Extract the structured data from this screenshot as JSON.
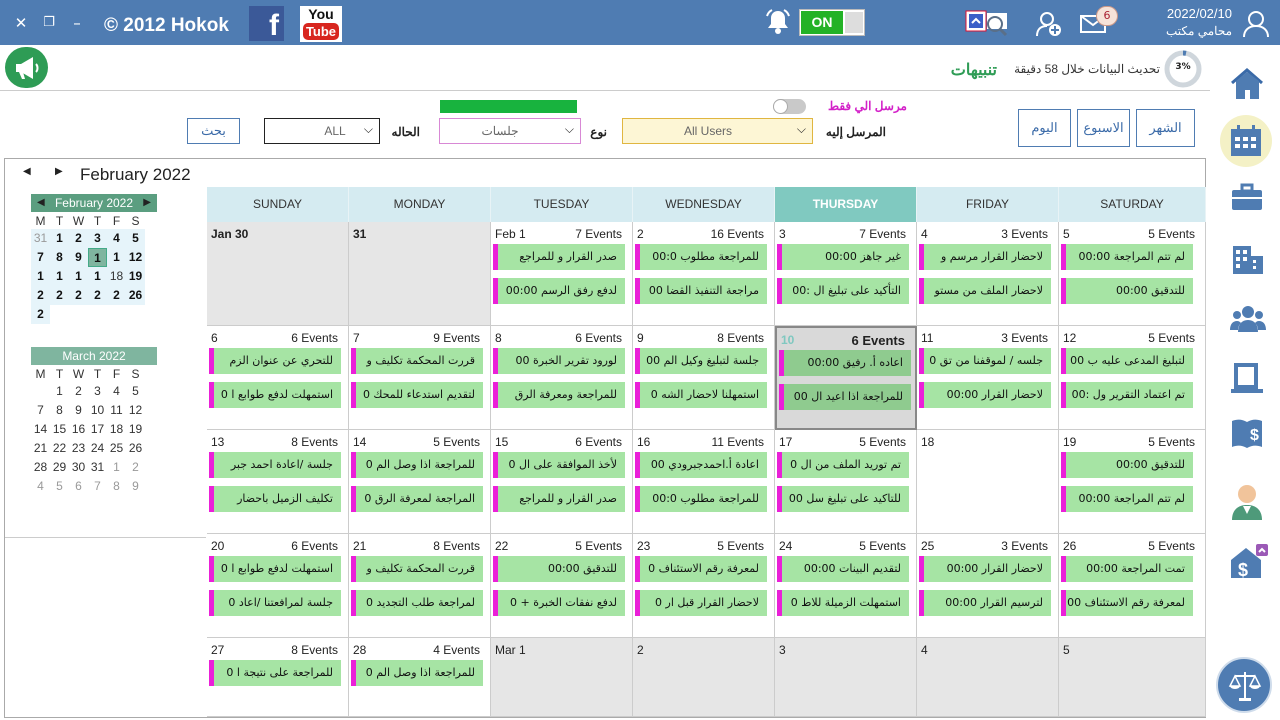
{
  "titlebar": {
    "brand": "© 2012 Hokok",
    "facebook_letter": "f",
    "youtube_you": "You",
    "youtube_tube": "Tube",
    "toggle_label": "ON",
    "mail_count": "6",
    "date": "2022/02/10",
    "user_role": "محامي مكتب",
    "accent": "#4f7cb2"
  },
  "notices": {
    "link": "تنبيهات",
    "update_text": "تحديث البيانات خلال 58 دقيقة",
    "progress_label": "3%",
    "progress_fraction": 0.03
  },
  "filters": {
    "view_month": "الشهر",
    "view_week": "الاسبوع",
    "view_today": "اليوم",
    "only_me_label": "مرسل الي فقط",
    "recipient_label": "المرسل إليه",
    "recipient_value": "All Users",
    "type_label": "نوع",
    "type_value": "جلسات",
    "status_label": "الحاله",
    "status_value": "ALL",
    "search_button": "بحث"
  },
  "calendar": {
    "month_title": "February 2022",
    "weekdays": [
      "SUNDAY",
      "MONDAY",
      "TUESDAY",
      "WEDNESDAY",
      "THURSDAY",
      "FRIDAY",
      "SATURDAY"
    ],
    "active_weekday": 4,
    "mini_dow": [
      "M",
      "T",
      "W",
      "T",
      "F",
      "S"
    ],
    "mini_feb": {
      "title": "February 2022",
      "rows": [
        [
          {
            "t": "31",
            "c": "o hl"
          },
          {
            "t": "1",
            "c": "b hl"
          },
          {
            "t": "2",
            "c": "b hl"
          },
          {
            "t": "3",
            "c": "b hl"
          },
          {
            "t": "4",
            "c": "b hl"
          },
          {
            "t": "5",
            "c": "b hl"
          }
        ],
        [
          {
            "t": "7",
            "c": "b hl"
          },
          {
            "t": "8",
            "c": "b hl"
          },
          {
            "t": "9",
            "c": "b hl"
          },
          {
            "t": "1",
            "c": "today"
          },
          {
            "t": "1",
            "c": "b hl"
          },
          {
            "t": "12",
            "c": "b hl"
          }
        ],
        [
          {
            "t": "1",
            "c": "b hl"
          },
          {
            "t": "1",
            "c": "b hl"
          },
          {
            "t": "1",
            "c": "b hl"
          },
          {
            "t": "1",
            "c": "b hl"
          },
          {
            "t": "18",
            "c": "hl"
          },
          {
            "t": "19",
            "c": "b hl"
          }
        ],
        [
          {
            "t": "2",
            "c": "b hl"
          },
          {
            "t": "2",
            "c": "b hl"
          },
          {
            "t": "2",
            "c": "b hl"
          },
          {
            "t": "2",
            "c": "b hl"
          },
          {
            "t": "2",
            "c": "b hl"
          },
          {
            "t": "26",
            "c": "b hl"
          }
        ],
        [
          {
            "t": "2",
            "c": "b hl"
          }
        ]
      ]
    },
    "mini_mar": {
      "title": "March 2022",
      "rows": [
        [
          {
            "t": "",
            "c": ""
          },
          {
            "t": "1",
            "c": ""
          },
          {
            "t": "2",
            "c": ""
          },
          {
            "t": "3",
            "c": ""
          },
          {
            "t": "4",
            "c": ""
          },
          {
            "t": "5",
            "c": ""
          }
        ],
        [
          {
            "t": "7",
            "c": ""
          },
          {
            "t": "8",
            "c": ""
          },
          {
            "t": "9",
            "c": ""
          },
          {
            "t": "10",
            "c": ""
          },
          {
            "t": "11",
            "c": ""
          },
          {
            "t": "12",
            "c": ""
          }
        ],
        [
          {
            "t": "14",
            "c": ""
          },
          {
            "t": "15",
            "c": ""
          },
          {
            "t": "16",
            "c": ""
          },
          {
            "t": "17",
            "c": ""
          },
          {
            "t": "18",
            "c": ""
          },
          {
            "t": "19",
            "c": ""
          }
        ],
        [
          {
            "t": "21",
            "c": ""
          },
          {
            "t": "22",
            "c": ""
          },
          {
            "t": "23",
            "c": ""
          },
          {
            "t": "24",
            "c": ""
          },
          {
            "t": "25",
            "c": ""
          },
          {
            "t": "26",
            "c": ""
          }
        ],
        [
          {
            "t": "28",
            "c": ""
          },
          {
            "t": "29",
            "c": ""
          },
          {
            "t": "30",
            "c": ""
          },
          {
            "t": "31",
            "c": ""
          },
          {
            "t": "1",
            "c": "o"
          },
          {
            "t": "2",
            "c": "o"
          }
        ],
        [
          {
            "t": "4",
            "c": "o"
          },
          {
            "t": "5",
            "c": "o"
          },
          {
            "t": "6",
            "c": "o"
          },
          {
            "t": "7",
            "c": "o"
          },
          {
            "t": "8",
            "c": "o"
          },
          {
            "t": "9",
            "c": "o"
          }
        ]
      ]
    },
    "weeks": [
      [
        {
          "label": "Jan 30",
          "bold": true,
          "grey": true,
          "count": "",
          "events": []
        },
        {
          "label": "31",
          "bold": true,
          "grey": true,
          "count": "",
          "events": []
        },
        {
          "label": "Feb 1",
          "count": "7 Events",
          "events": [
            "صدر القرار و للمراجع",
            "لدفع رفق الرسم   00:00"
          ]
        },
        {
          "label": "2",
          "count": "16 Events",
          "events": [
            "للمراجعة مطلوب 00:0",
            "مراجعة التنفيذ القضا 00"
          ]
        },
        {
          "label": "3",
          "count": "7 Events",
          "events": [
            "غير جاهز   00:00",
            "التأكيد على تبليغ ال :00"
          ]
        },
        {
          "label": "4",
          "count": "3 Events",
          "events": [
            "لاحضار القرار مرسم و",
            "لاحضار الملف من مستو"
          ]
        },
        {
          "label": "5",
          "count": "5 Events",
          "events": [
            "لم تتم المراجعة   00:00",
            "للتدقيق 00:00"
          ]
        }
      ],
      [
        {
          "label": "6",
          "count": "6 Events",
          "events": [
            "للتحري عن عنوان الزم",
            "استمهلت لدفع طوابع ا 0"
          ]
        },
        {
          "label": "7",
          "count": "9 Events",
          "events": [
            "قررت المحكمة تكليف و",
            "لتقديم استدعاء للمحك 0"
          ]
        },
        {
          "label": "8",
          "count": "6 Events",
          "events": [
            "لورود تقرير الخبرة  00",
            "للمراجعة ومعرفة الرق"
          ]
        },
        {
          "label": "9",
          "count": "8 Events",
          "events": [
            "جلسة لتبليغ وكيل الم 00",
            "استمهلنا لاحضار الشه 0"
          ]
        },
        {
          "label": "10",
          "teal": true,
          "selected": true,
          "count": "6 Events",
          "count_bold": true,
          "events": [
            "اعاده أ. رفيق   00:00",
            "للمراجعة اذا اعيد ال 00"
          ]
        },
        {
          "label": "11",
          "count": "3 Events",
          "events": [
            "جلسه / لموقفنا من تق 0",
            "لاحضار القرار 00:00"
          ]
        },
        {
          "label": "12",
          "count": "5 Events",
          "events": [
            "لتبليغ المدعى عليه ب  00",
            "تم اعتماد التقرير ول :00"
          ]
        }
      ],
      [
        {
          "label": "13",
          "count": "8 Events",
          "events": [
            "جلسة /اعادة احمد جبر",
            "تكليف الزميل باحضار"
          ]
        },
        {
          "label": "14",
          "count": "5 Events",
          "events": [
            "للمراجعة اذا وصل الم 0",
            "المراجعة لمعرفة الرق 0"
          ]
        },
        {
          "label": "15",
          "count": "6 Events",
          "events": [
            "لأخذ الموافقة على ال 0",
            "صدر القرار و للمراجع"
          ]
        },
        {
          "label": "16",
          "count": "11 Events",
          "events": [
            "اعادة أ.احمدجبرودي 00",
            "للمراجعة مطلوب 00:0"
          ]
        },
        {
          "label": "17",
          "count": "5 Events",
          "events": [
            "تم توريد الملف من ال 0",
            "للتاكيد على تبليغ سل 00"
          ]
        },
        {
          "label": "18",
          "count": "",
          "events": []
        },
        {
          "label": "19",
          "count": "5 Events",
          "events": [
            "للتدقيق 00:00",
            "لم تتم المراجعة   00:00"
          ]
        }
      ],
      [
        {
          "label": "20",
          "count": "6 Events",
          "events": [
            "استمهلت لدفع طوابع ا 0",
            "جلسة لمرافعتنا /اعاد 0"
          ]
        },
        {
          "label": "21",
          "count": "8 Events",
          "events": [
            "قررت المحكمة تكليف و",
            "لمراجعة طلب التجديد 0"
          ]
        },
        {
          "label": "22",
          "count": "5 Events",
          "events": [
            "للتدقيق 00:00",
            "لدفع نفقات الخبرة +  0"
          ]
        },
        {
          "label": "23",
          "count": "5 Events",
          "events": [
            "لمعرفة رقم الاستئناف 0",
            "لاحضار القرار قبل ار 0"
          ]
        },
        {
          "label": "24",
          "count": "5 Events",
          "events": [
            "لتقديم البينات 00:00",
            "استمهلت الزميلة للاط 0"
          ]
        },
        {
          "label": "25",
          "count": "3 Events",
          "events": [
            "لاحضار القرار 00:00",
            "لترسيم القرار 00:00"
          ]
        },
        {
          "label": "26",
          "count": "5 Events",
          "events": [
            "تمت المراجعة   00:00",
            "لمعرفة رقم الاستئناف 00"
          ]
        }
      ],
      [
        {
          "label": "27",
          "count": "8 Events",
          "events": [
            "للمراجعة على نتيجة ا 0"
          ]
        },
        {
          "label": "28",
          "count": "4 Events",
          "events": [
            "للمراجعة اذا وصل الم 0"
          ]
        },
        {
          "label": "Mar 1",
          "grey": true,
          "count": "",
          "events": []
        },
        {
          "label": "2",
          "grey": true,
          "count": "",
          "events": []
        },
        {
          "label": "3",
          "grey": true,
          "count": "",
          "events": []
        },
        {
          "label": "4",
          "grey": true,
          "count": "",
          "events": []
        },
        {
          "label": "5",
          "grey": true,
          "count": "",
          "events": []
        }
      ]
    ]
  },
  "colors": {
    "event_bg": "#a6e4a4",
    "event_accent": "#ea20d8",
    "active_weekday_bg": "#80c9c0",
    "header_bg": "#d5ebf1"
  }
}
